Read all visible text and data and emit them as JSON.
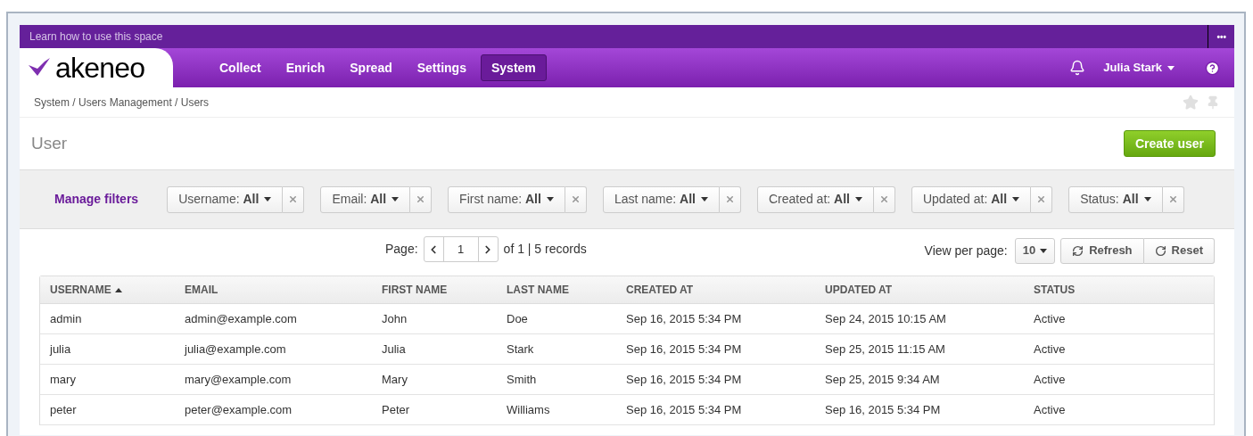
{
  "help_bar": {
    "text": "Learn how to use this space",
    "menu": "•••"
  },
  "nav": {
    "logo": "akeneo",
    "items": [
      {
        "label": "Collect",
        "selected": false
      },
      {
        "label": "Enrich",
        "selected": false
      },
      {
        "label": "Spread",
        "selected": false
      },
      {
        "label": "Settings",
        "selected": false
      },
      {
        "label": "System",
        "selected": true
      }
    ],
    "user": "Julia Stark"
  },
  "breadcrumb": "System / Users Management / Users",
  "title": "User",
  "create_button": "Create user",
  "filters": {
    "manage": "Manage filters",
    "items": [
      {
        "label": "Username:",
        "value": "All"
      },
      {
        "label": "Email:",
        "value": "All"
      },
      {
        "label": "First name:",
        "value": "All"
      },
      {
        "label": "Last name:",
        "value": "All"
      },
      {
        "label": "Created at:",
        "value": "All"
      },
      {
        "label": "Updated at:",
        "value": "All"
      },
      {
        "label": "Status:",
        "value": "All"
      }
    ]
  },
  "pagination": {
    "label": "Page:",
    "page": "1",
    "summary": "of 1 | 5 records",
    "per_page_label": "View per page:",
    "per_page": "10",
    "refresh": "Refresh",
    "reset": "Reset"
  },
  "table": {
    "columns": [
      {
        "label": "USERNAME",
        "sorted": true
      },
      {
        "label": "EMAIL",
        "sorted": false
      },
      {
        "label": "FIRST NAME",
        "sorted": false
      },
      {
        "label": "LAST NAME",
        "sorted": false
      },
      {
        "label": "CREATED AT",
        "sorted": false
      },
      {
        "label": "UPDATED AT",
        "sorted": false
      },
      {
        "label": "STATUS",
        "sorted": false
      }
    ],
    "rows": [
      [
        "admin",
        "admin@example.com",
        "John",
        "Doe",
        "Sep 16, 2015 5:34 PM",
        "Sep 24, 2015 10:15 AM",
        "Active"
      ],
      [
        "julia",
        "julia@example.com",
        "Julia",
        "Stark",
        "Sep 16, 2015 5:34 PM",
        "Sep 25, 2015 11:15 AM",
        "Active"
      ],
      [
        "mary",
        "mary@example.com",
        "Mary",
        "Smith",
        "Sep 16, 2015 5:34 PM",
        "Sep 25, 2015 9:34 AM",
        "Active"
      ],
      [
        "peter",
        "peter@example.com",
        "Peter",
        "Williams",
        "Sep 16, 2015 5:34 PM",
        "Sep 16, 2015 5:34 PM",
        "Active"
      ]
    ]
  }
}
